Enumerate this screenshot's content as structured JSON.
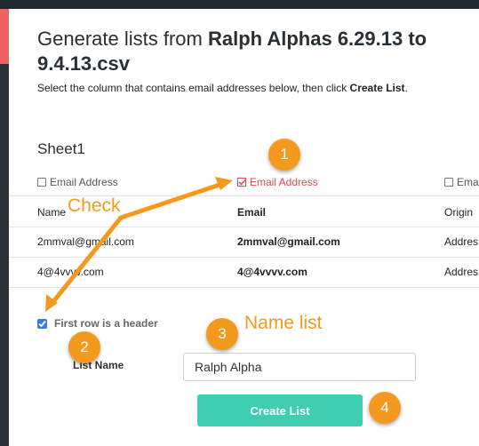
{
  "title": {
    "prefix": "Generate lists from ",
    "filename_line1": "Ralph Alphas 6.29.13 to",
    "filename_line2": "9.4.13.csv"
  },
  "subtitle": {
    "text": "Select the column that contains email addresses below, then click ",
    "action": "Create List",
    "end": "."
  },
  "sheet": {
    "name": "Sheet1"
  },
  "columns": [
    {
      "label": "Email Address",
      "checked": false
    },
    {
      "label": "Email Address",
      "checked": true
    },
    {
      "label": "Emai",
      "checked": false
    }
  ],
  "table": {
    "header_row": [
      "Name",
      "Email",
      "Origin"
    ],
    "rows": [
      [
        "2mmval@gmail.com",
        "2mmval@gmail.com",
        "Addres"
      ],
      [
        "4@4vvvv.com",
        "4@4vvvv.com",
        "Addres"
      ]
    ]
  },
  "header_option": {
    "label": "First row is a header",
    "checked": true
  },
  "list_name": {
    "label": "List Name",
    "value": "Ralph Alpha"
  },
  "create_button": {
    "label": "Create List"
  },
  "annotations": {
    "check": "Check",
    "name_list": "Name list",
    "badges": [
      "1",
      "2",
      "3",
      "4"
    ]
  },
  "colors": {
    "accent_red": "#e0484c",
    "checkbox_blue": "#2f7de1",
    "button_teal": "#3fcfb0",
    "annotation_orange": "#f39a1e"
  }
}
